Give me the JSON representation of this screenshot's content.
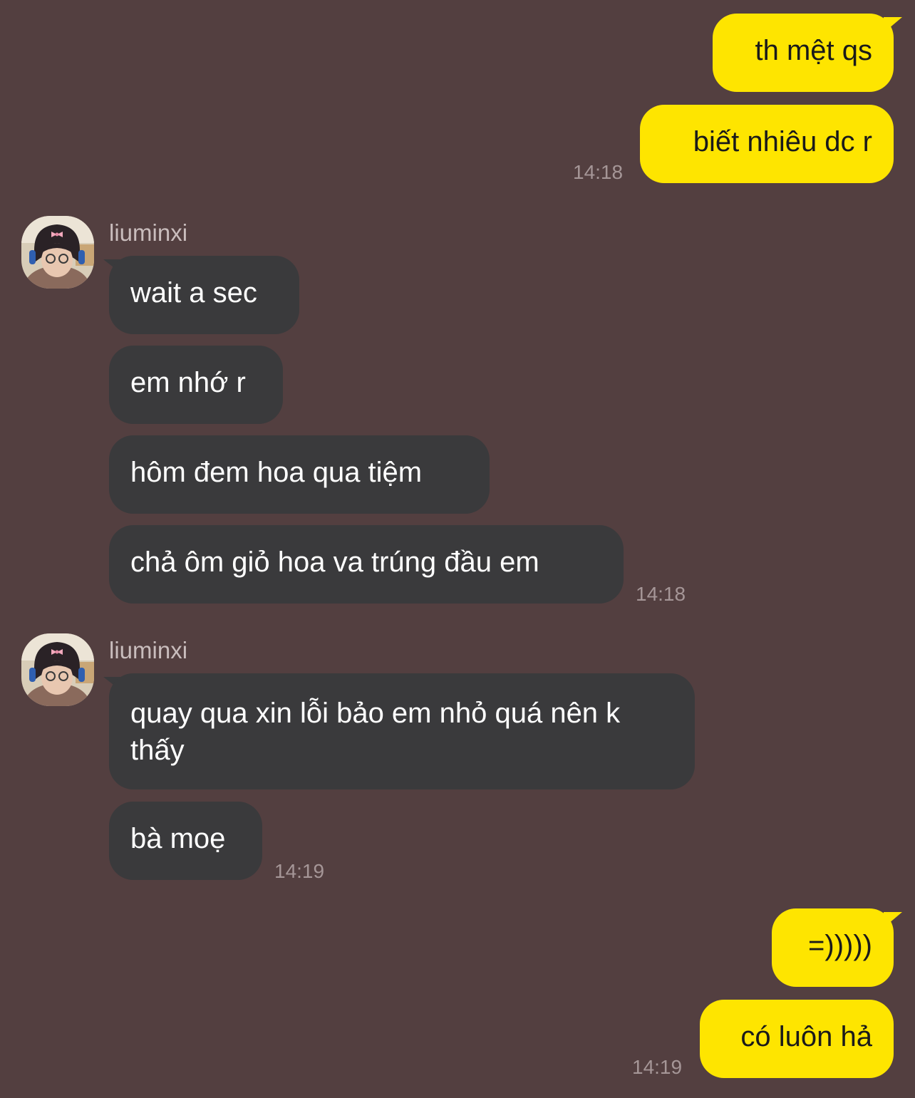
{
  "colors": {
    "background": "#533f40",
    "outgoing_bubble": "#fee500",
    "incoming_bubble": "#3a3a3c",
    "timestamp": "#a59697"
  },
  "groups": [
    {
      "direction": "outgoing",
      "messages": [
        "th mệt qs",
        "biết nhiêu dc r"
      ],
      "time": "14:18"
    },
    {
      "direction": "incoming",
      "sender": "liuminxi",
      "avatar_icon": "profile-photo-icon",
      "messages": [
        "wait a sec",
        "em nhớ r",
        "hôm đem hoa qua tiệm",
        "chả ôm giỏ hoa va trúng đầu em"
      ],
      "time": "14:18"
    },
    {
      "direction": "incoming",
      "sender": "liuminxi",
      "avatar_icon": "profile-photo-icon",
      "messages": [
        "quay qua xin lỗi bảo em nhỏ quá nên k thấy",
        "bà moẹ"
      ],
      "time": "14:19"
    },
    {
      "direction": "outgoing",
      "messages": [
        "=)))))",
        "có luôn hả"
      ],
      "time": "14:19"
    }
  ]
}
